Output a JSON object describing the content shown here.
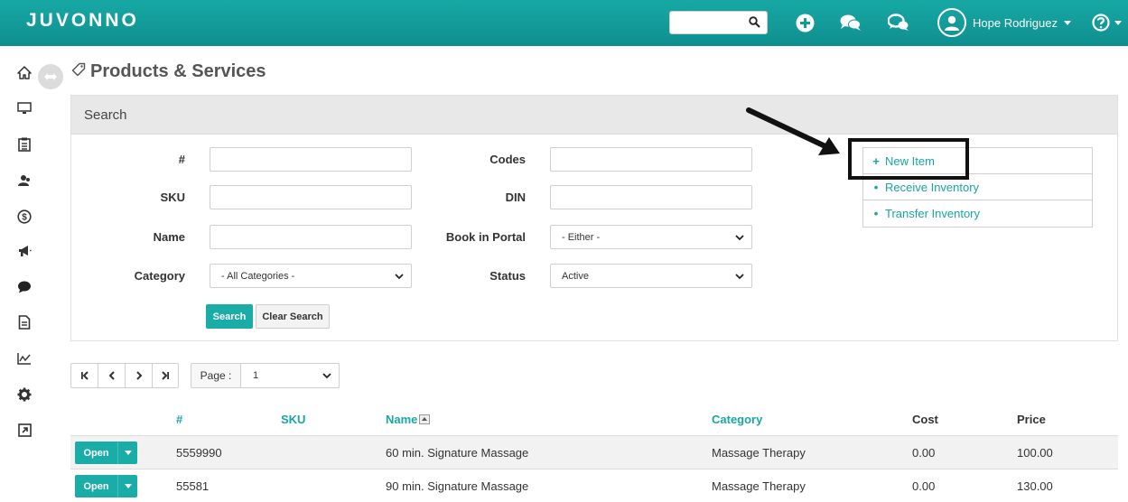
{
  "app": {
    "logo": "JUVONNO"
  },
  "header": {
    "search_placeholder": "",
    "user_name": "Hope Rodriguez"
  },
  "page": {
    "title": "Products & Services"
  },
  "search_panel": {
    "heading": "Search",
    "fields": {
      "number_label": "#",
      "sku_label": "SKU",
      "name_label": "Name",
      "category_label": "Category",
      "category_value": "- All Categories -",
      "codes_label": "Codes",
      "din_label": "DIN",
      "book_in_portal_label": "Book in Portal",
      "book_in_portal_value": "- Either -",
      "status_label": "Status",
      "status_value": "Active"
    },
    "search_button": "Search",
    "clear_button": "Clear Search"
  },
  "actions": [
    {
      "bullet": "+",
      "label": "New Item"
    },
    {
      "bullet": "•",
      "label": "Receive Inventory"
    },
    {
      "bullet": "•",
      "label": "Transfer Inventory"
    }
  ],
  "pager": {
    "page_label": "Page :",
    "page_value": "1"
  },
  "table": {
    "columns": {
      "number": "#",
      "sku": "SKU",
      "name": "Name",
      "category": "Category",
      "cost": "Cost",
      "price": "Price"
    },
    "open_label": "Open",
    "rows": [
      {
        "number": "5559990",
        "sku": "",
        "name": "60 min. Signature Massage",
        "category": "Massage Therapy",
        "cost": "0.00",
        "price": "100.00"
      },
      {
        "number": "55581",
        "sku": "",
        "name": "90 min. Signature Massage",
        "category": "Massage Therapy",
        "cost": "0.00",
        "price": "130.00"
      }
    ]
  },
  "colors": {
    "brand": "#17a9a5",
    "accent_button": "#1aada8",
    "link": "#18a6a2"
  }
}
